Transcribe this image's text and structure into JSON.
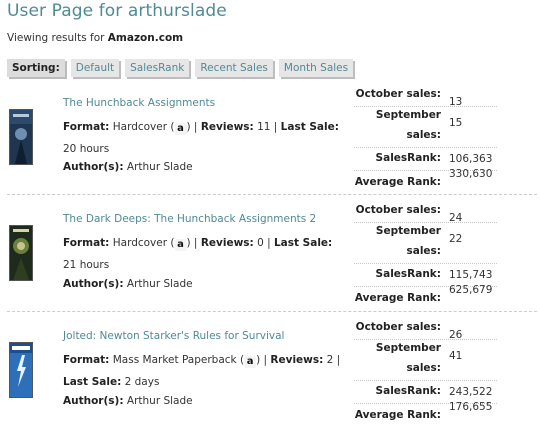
{
  "page": {
    "title": "User Page for arthurslade",
    "viewing_prefix": "Viewing results for",
    "viewing_site": "Amazon.com"
  },
  "sorting": {
    "label": "Sorting:",
    "options": [
      "Default",
      "SalesRank",
      "Recent Sales",
      "Month Sales"
    ]
  },
  "labels": {
    "format": "Format:",
    "reviews": "Reviews:",
    "last_sale": "Last Sale:",
    "authors": "Author(s):",
    "october_sales": "October sales:",
    "september_line1": "September",
    "september_line2": "sales:",
    "sales_rank": "SalesRank:",
    "average_rank": "Average Rank:",
    "amazon_glyph": "a"
  },
  "colors": {
    "link": "#4f8a96",
    "sort_bg": "#e6e6e6"
  },
  "books": [
    {
      "title": "The Hunchback Assignments",
      "format": "Hardcover",
      "reviews": "11",
      "last_sale": "20 hours",
      "authors": "Arthur Slade",
      "october_sales": "13",
      "september_sales": "15",
      "sales_rank": "106,363",
      "average_rank": "330,630",
      "cover_icon": "book-cover-dark-blue"
    },
    {
      "title": "The Dark Deeps: The Hunchback Assignments 2",
      "format": "Hardcover",
      "reviews": "0",
      "last_sale": "21 hours",
      "authors": "Arthur Slade",
      "october_sales": "24",
      "september_sales": "22",
      "sales_rank": "115,743",
      "average_rank": "625,679",
      "cover_icon": "book-cover-dark-green"
    },
    {
      "title": "Jolted: Newton Starker's Rules for Survival",
      "format": "Mass Market Paperback",
      "reviews": "2",
      "last_sale": "2 days",
      "authors": "Arthur Slade",
      "october_sales": "26",
      "september_sales": "41",
      "sales_rank": "243,522",
      "average_rank": "176,655",
      "cover_icon": "book-cover-blue-lightning"
    }
  ]
}
